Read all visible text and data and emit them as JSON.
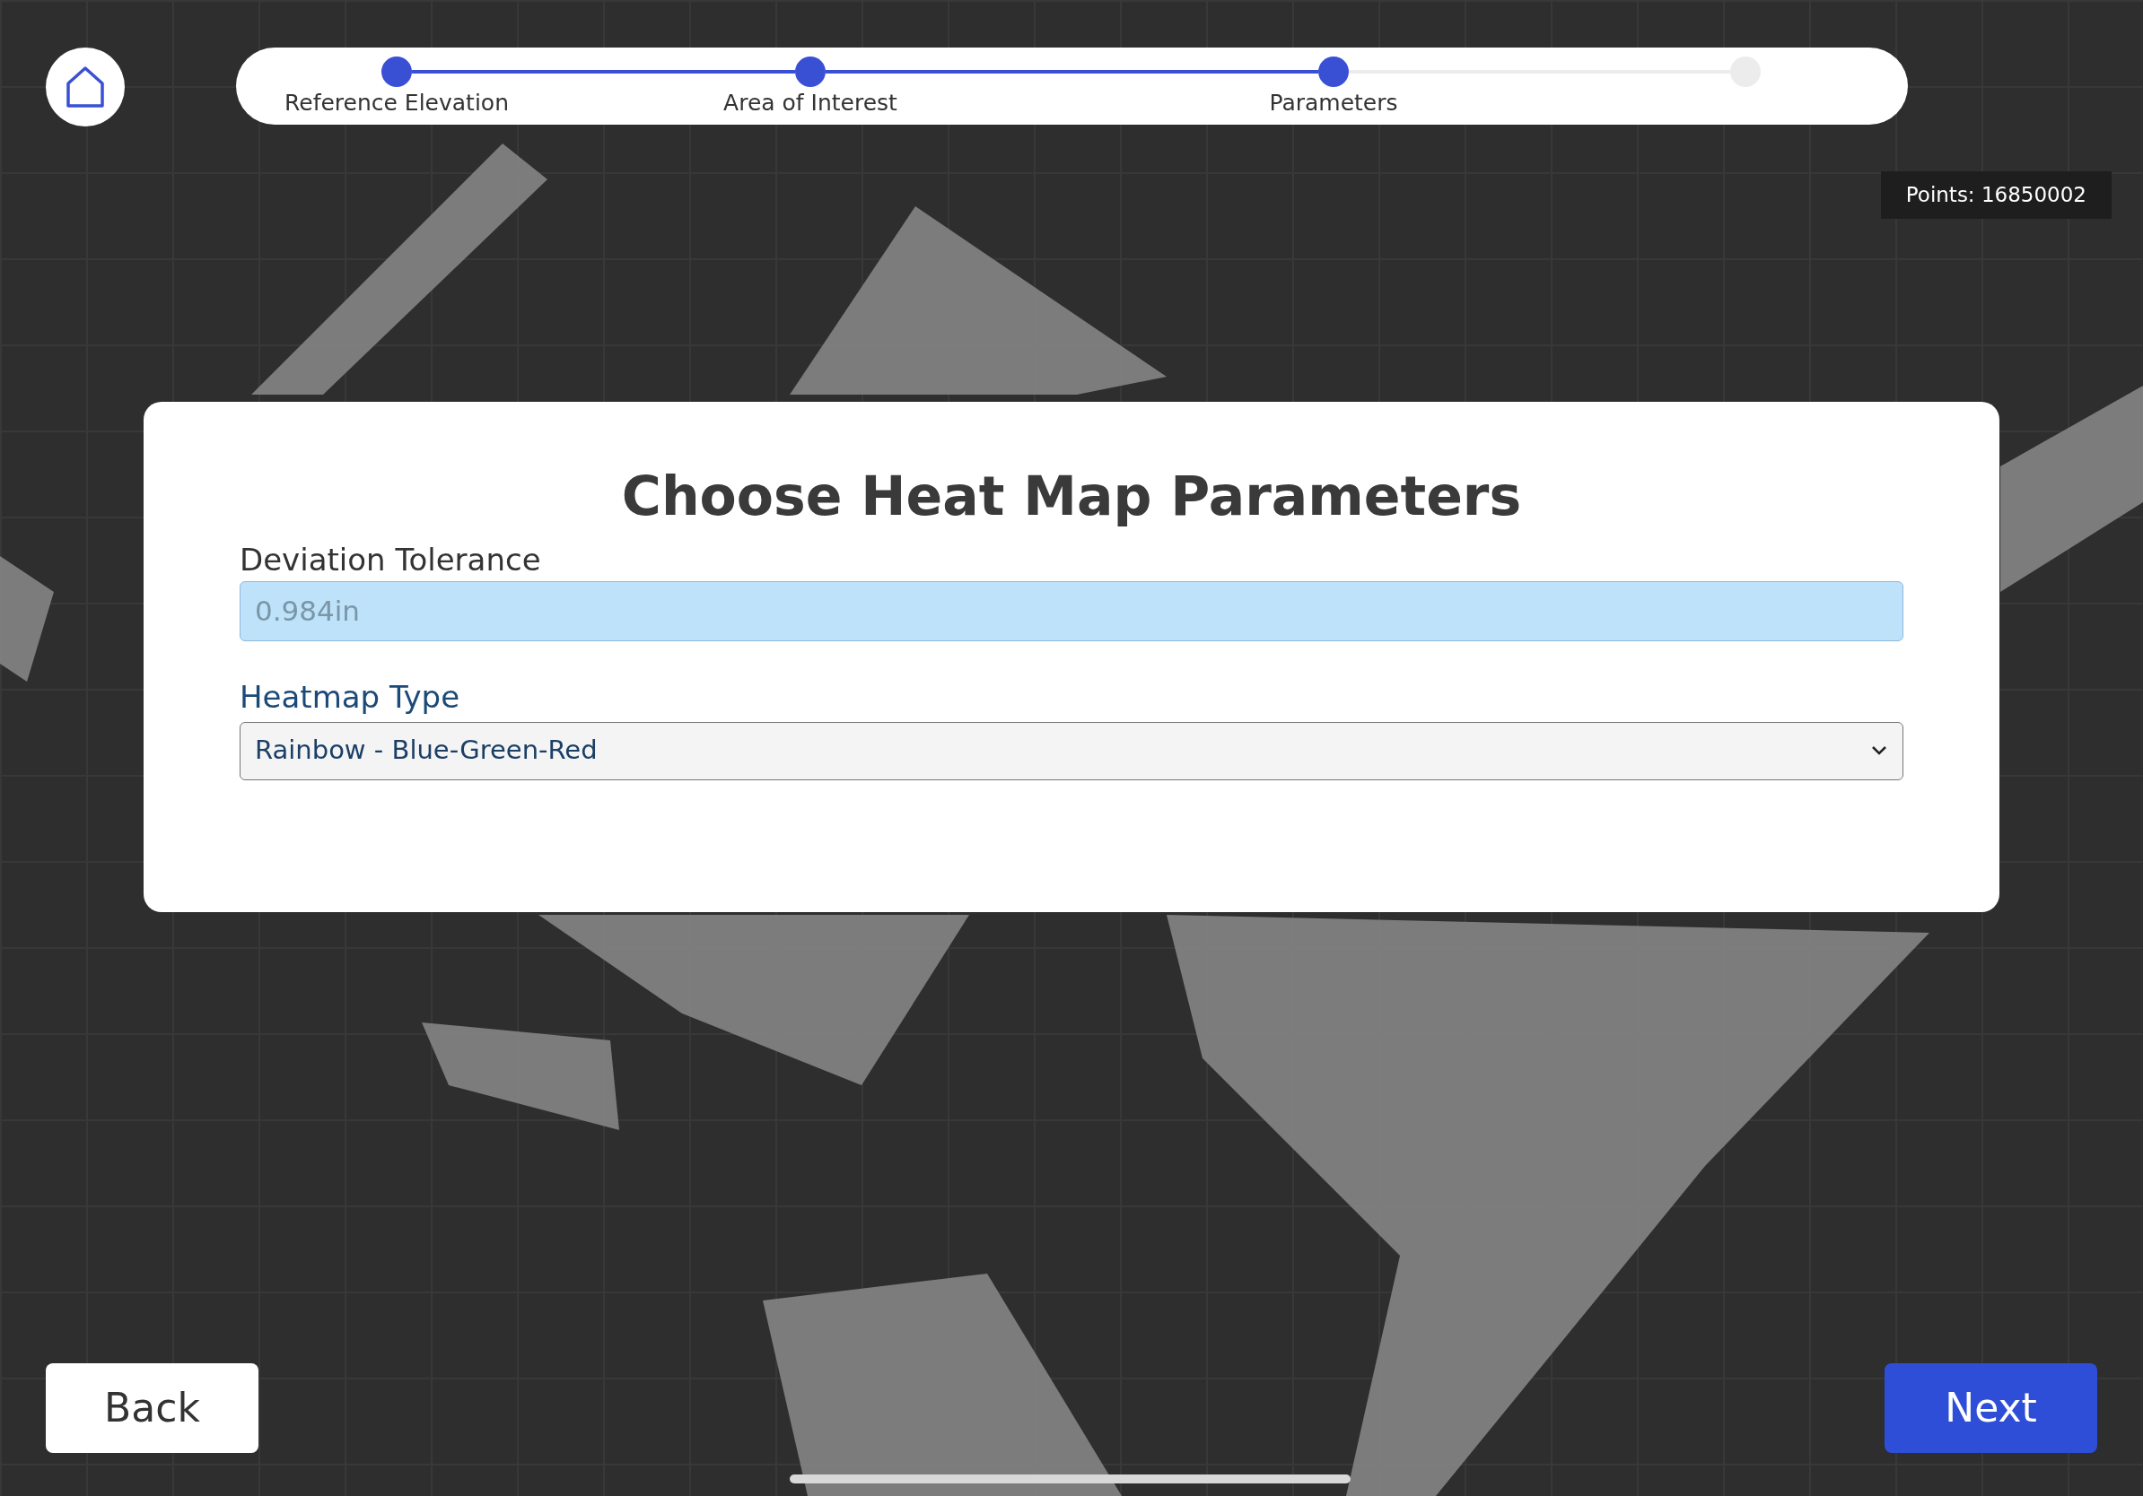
{
  "stepper": [
    {
      "label": "Reference Elevation",
      "completed": true
    },
    {
      "label": "Area of Interest",
      "completed": true
    },
    {
      "label": "Parameters",
      "completed": true
    },
    {
      "completed": false
    }
  ],
  "points_badge": "Points: 16850002",
  "dialog": {
    "title": "Choose Heat Map Parameters",
    "fields": [
      {
        "kind": "input",
        "label": "Deviation Tolerance",
        "placeholder": "0.984in"
      },
      {
        "kind": "select",
        "label": "Heatmap Type",
        "value": "Rainbow - Blue-Green-Red"
      }
    ]
  },
  "buttons": {
    "back": "Back",
    "next": "Next"
  }
}
